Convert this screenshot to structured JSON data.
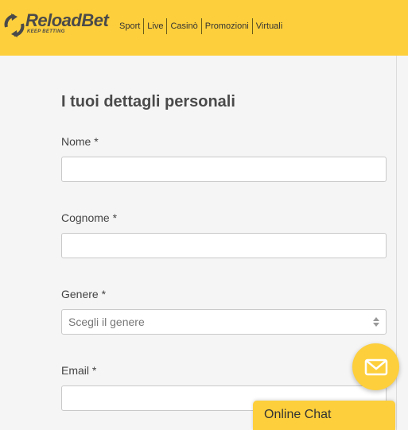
{
  "brand": {
    "name_part1": "Reload",
    "name_part2": "Bet",
    "tagline": "KEEP BETTING",
    "color": "#fdcf3c"
  },
  "nav": {
    "items": [
      "Sport",
      "Live",
      "Casinò",
      "Promozioni",
      "Virtuali"
    ]
  },
  "page": {
    "title": "I tuoi dettagli personali"
  },
  "form": {
    "nome": {
      "label": "Nome *",
      "value": ""
    },
    "cognome": {
      "label": "Cognome *",
      "value": ""
    },
    "genere": {
      "label": "Genere *",
      "selected": "Scegli il genere"
    },
    "email": {
      "label": "Email *",
      "value": ""
    }
  },
  "chat": {
    "label": "Online Chat",
    "icon": "mail-icon"
  }
}
